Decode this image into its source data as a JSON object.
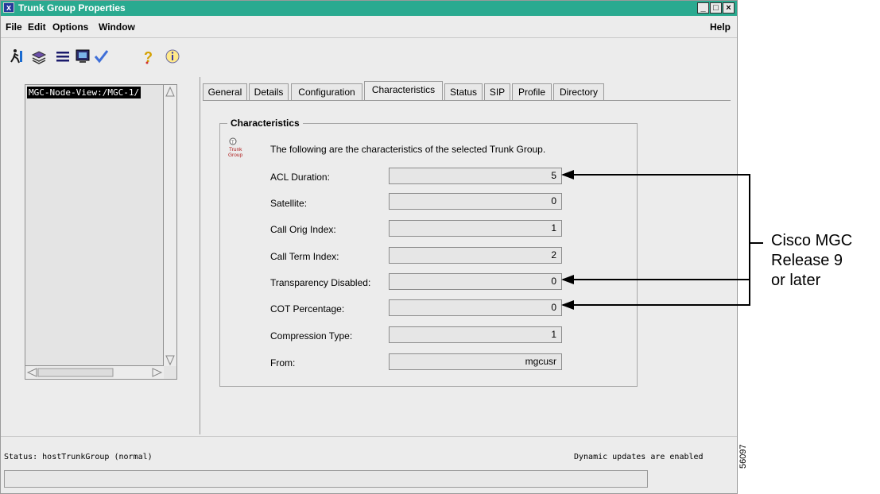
{
  "window": {
    "title": "Trunk Group Properties",
    "controls": [
      "_",
      "□",
      "×"
    ]
  },
  "menu": {
    "items": [
      {
        "label": "File"
      },
      {
        "label": "Edit"
      },
      {
        "label": "Options"
      },
      {
        "label": "Window"
      }
    ],
    "help": "Help"
  },
  "toolbar": {
    "icons": [
      "run-icon",
      "layers-icon",
      "list-icon",
      "monitor-icon",
      "checkmark-icon",
      "question-icon",
      "info-icon"
    ]
  },
  "tree": {
    "selected": "MGC-Node-View:/MGC-1/"
  },
  "tabs": [
    {
      "label": "General"
    },
    {
      "label": "Details"
    },
    {
      "label": "Configuration"
    },
    {
      "label": "Characteristics",
      "active": true
    },
    {
      "label": "Status"
    },
    {
      "label": "SIP"
    },
    {
      "label": "Profile"
    },
    {
      "label": "Directory"
    }
  ],
  "characteristics": {
    "title": "Characteristics",
    "icon_text": [
      "Trunk",
      "Group"
    ],
    "description": "The following are the characteristics of the selected Trunk Group.",
    "fields": [
      {
        "label": "ACL Duration:",
        "value": "5"
      },
      {
        "label": "Satellite:",
        "value": "0"
      },
      {
        "label": "Call Orig Index:",
        "value": "1"
      },
      {
        "label": "Call Term Index:",
        "value": "2"
      },
      {
        "label": "Transparency Disabled:",
        "value": "0"
      },
      {
        "label": "COT Percentage:",
        "value": "0"
      },
      {
        "label": "Compression Type:",
        "value": "1"
      },
      {
        "label": "From:",
        "value": "mgcusr"
      }
    ]
  },
  "status": {
    "text": "Status: hostTrunkGroup (normal)",
    "updates": "Dynamic updates are enabled"
  },
  "callout": {
    "lines": [
      "Cisco MGC",
      "Release 9",
      "or later"
    ]
  },
  "figure_id": "56097",
  "colors": {
    "titlebar": "#2aaa90",
    "window_bg": "#ececec"
  }
}
